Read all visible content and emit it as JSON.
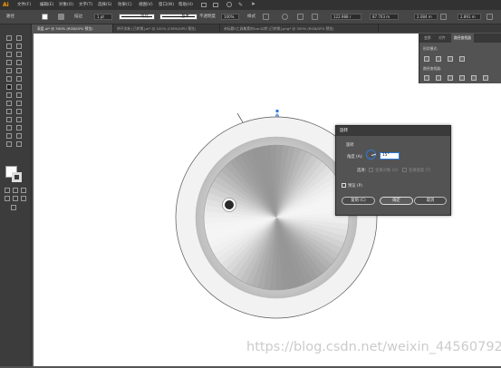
{
  "app": {
    "logo": "Ai"
  },
  "menubar": {
    "items": [
      "文件(F)",
      "编辑(E)",
      "对象(O)",
      "文字(T)",
      "选择(S)",
      "效果(C)",
      "视图(V)",
      "窗口(W)",
      "帮助(H)"
    ]
  },
  "control_bar": {
    "selection_label": "路径",
    "stroke_label": "描边",
    "stroke_value": "1 pt",
    "profile_label": "等比",
    "brush_label": "基本",
    "opacity_label": "不透明度",
    "opacity_value": "100%",
    "style_label": "样式",
    "x_value": "122.988 r",
    "y_value": "87.703 m",
    "w_value": "2.084 m",
    "h_value": "2.891 m"
  },
  "tabs": [
    {
      "label": "表盘.ai* @ 300% (RGB/GPU 预览)",
      "active": true
    },
    {
      "label": "钟开发新 [已转换].ai* @ 100% (CMYK/GPU 预览)",
      "active": false
    },
    {
      "label": "未标题0工具集素材icon以转 [已转换].png* @ 300% (RGB/GPU 预览)",
      "active": false
    }
  ],
  "panel": {
    "tabs": [
      "变换",
      "对齐",
      "路径查找器"
    ],
    "shape_modes_label": "形状模式:",
    "pathfinders_label": "路径查找器:"
  },
  "dialog": {
    "title": "旋转",
    "section_label": "旋转",
    "angle_label": "角度 (A):",
    "angle_value": "15°",
    "options_label": "选项:",
    "transform_objects": "变换对象 (O)",
    "transform_patterns": "变换图案 (T)",
    "preview_label": "预览 (P)",
    "copy_button": "复制 (C)",
    "ok_button": "确定",
    "cancel_button": "取消"
  },
  "watermark": "https://blog.csdn.net/weixin_44560792",
  "colors": {
    "accent": "#2d7bd6",
    "dark_bg": "#535353",
    "canvas": "#ffffff",
    "logo": "#ff9a00"
  }
}
